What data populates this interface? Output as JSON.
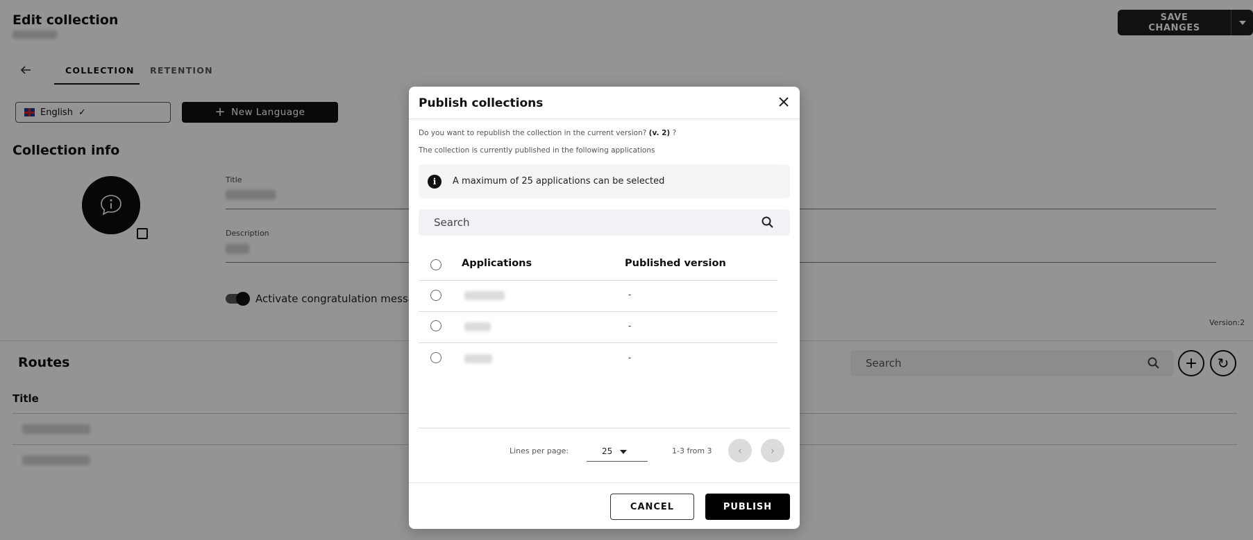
{
  "header": {
    "title": "Edit collection",
    "save_label": "SAVE CHANGES"
  },
  "tabs": [
    {
      "label": "COLLECTION",
      "active": true
    },
    {
      "label": "RETENTION",
      "active": false
    }
  ],
  "language": {
    "current": "English",
    "new_language_label": "New Language"
  },
  "collection_info": {
    "section_title": "Collection info",
    "title_label": "Title",
    "description_label": "Description",
    "toggle_label": "Activate congratulation messag",
    "version_text": "Version:2"
  },
  "routes": {
    "title": "Routes",
    "search_placeholder": "Search",
    "column_title": "Title"
  },
  "modal": {
    "title": "Publish collections",
    "question_prefix": "Do you want to republish the collection in the current version?",
    "question_version": "(v. 2)",
    "question_suffix": "?",
    "published_text": "The collection is currently published in the following applications",
    "info_text": "A maximum of 25 applications can be selected",
    "search_placeholder": "Search",
    "columns": {
      "applications": "Applications",
      "published_version": "Published version"
    },
    "rows": [
      {
        "published_version": "-"
      },
      {
        "published_version": "-"
      },
      {
        "published_version": "-"
      }
    ],
    "pagination": {
      "lines_label": "Lines per page:",
      "per_page": "25",
      "range": "1-3 from 3"
    },
    "cancel_label": "CANCEL",
    "publish_label": "PUBLISH"
  },
  "colors": {
    "overlay": "#000000",
    "primary_button": "#000000",
    "save_button": "#1f1f1f"
  }
}
